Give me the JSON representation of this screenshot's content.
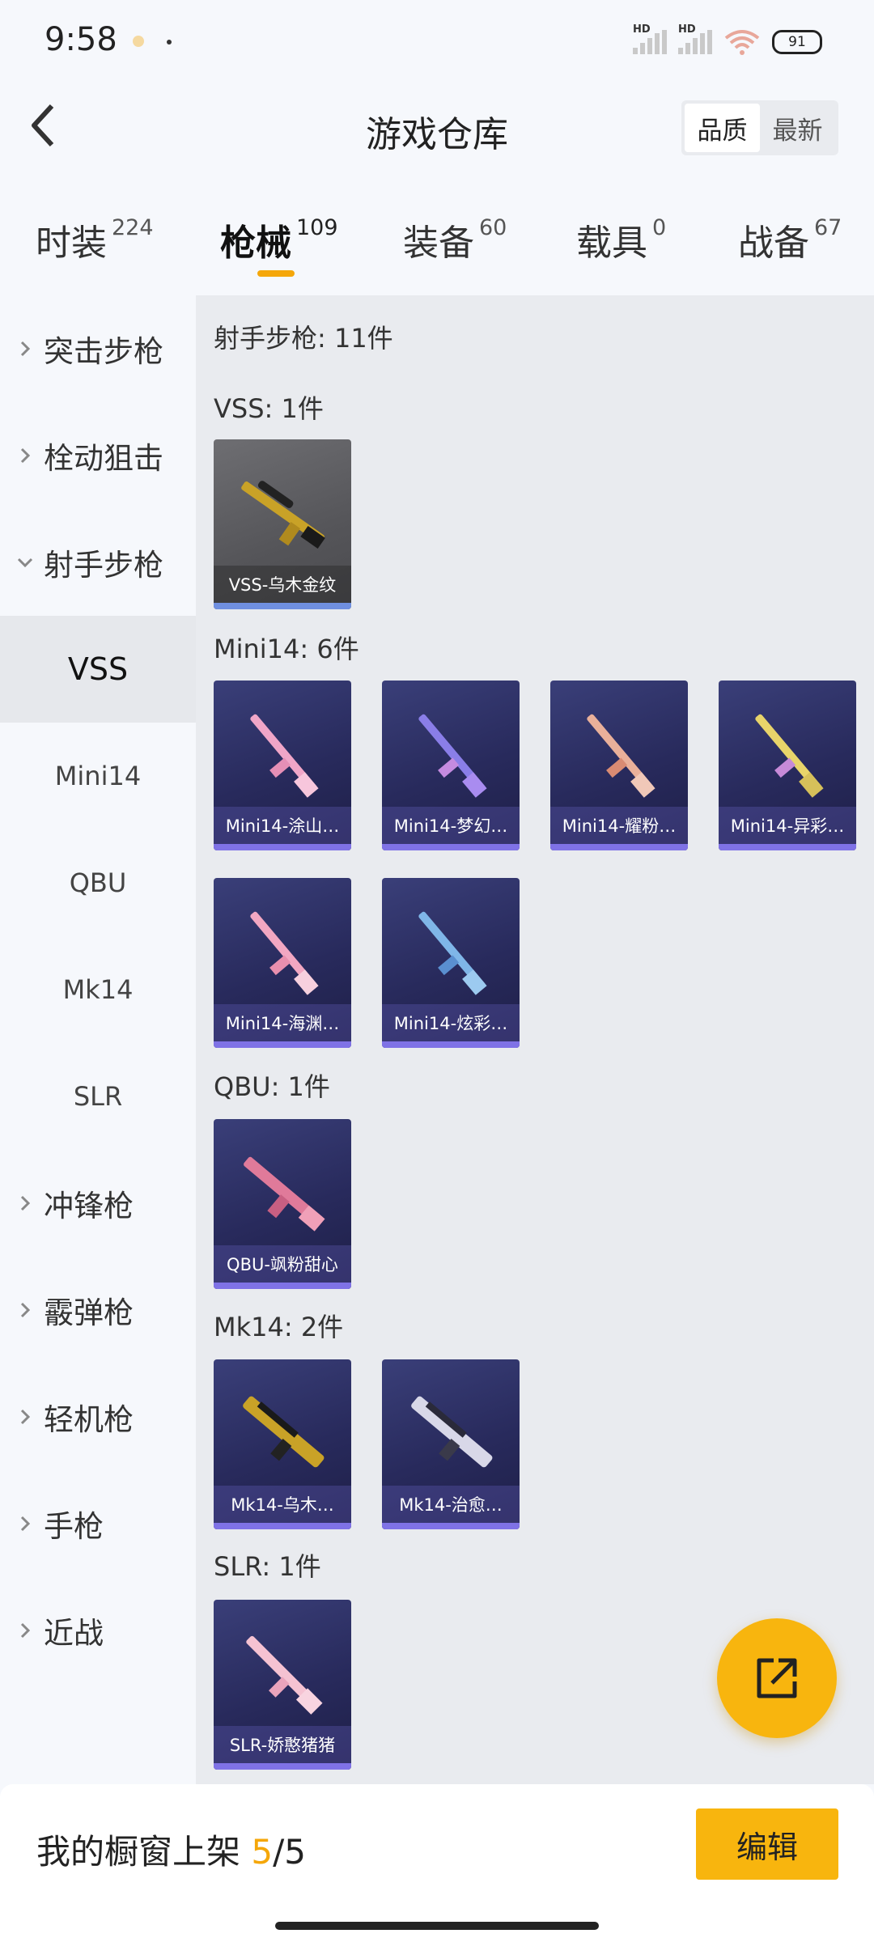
{
  "status_bar": {
    "time": "9:58",
    "battery": "91",
    "signal_label_1": "HD",
    "signal_label_2": "HD"
  },
  "header": {
    "title": "游戏仓库",
    "sort_options": [
      "品质",
      "最新"
    ],
    "sort_active": "品质"
  },
  "tabs": [
    {
      "label": "时装",
      "count": "224"
    },
    {
      "label": "枪械",
      "count": "109",
      "active": true
    },
    {
      "label": "装备",
      "count": "60"
    },
    {
      "label": "载具",
      "count": "0"
    },
    {
      "label": "战备",
      "count": "67"
    }
  ],
  "sidebar": {
    "categories": [
      "突击步枪",
      "栓动狙击",
      "射手步枪",
      "冲锋枪",
      "霰弹枪",
      "轻机枪",
      "手枪",
      "近战"
    ],
    "expanded": "射手步枪",
    "subs": [
      "VSS",
      "Mini14",
      "QBU",
      "Mk14",
      "SLR"
    ],
    "active_sub": "VSS"
  },
  "content": {
    "category_title": "射手步枪: 11件",
    "groups": [
      {
        "title": "VSS: 1件",
        "items": [
          "VSS-乌木金纹"
        ]
      },
      {
        "title": "Mini14: 6件",
        "items": [
          "Mini14-涂山…",
          "Mini14-梦幻…",
          "Mini14-耀粉…",
          "Mini14-异彩…",
          "Mini14-海渊…",
          "Mini14-炫彩…"
        ]
      },
      {
        "title": "QBU: 1件",
        "items": [
          "QBU-飒粉甜心"
        ]
      },
      {
        "title": "Mk14: 2件",
        "items": [
          "Mk14-乌木…",
          "Mk14-治愈…"
        ]
      },
      {
        "title": "SLR: 1件",
        "items": [
          "SLR-娇憨猪猪"
        ]
      }
    ]
  },
  "bottom_bar": {
    "label": "我的橱窗上架",
    "current": "5",
    "total": "/5",
    "edit_label": "编辑"
  },
  "colors": {
    "accent": "#f5a70a",
    "card_bg": "#2a2c60",
    "card_bar": "#7f72e6",
    "content_bg": "#e9ebef"
  }
}
